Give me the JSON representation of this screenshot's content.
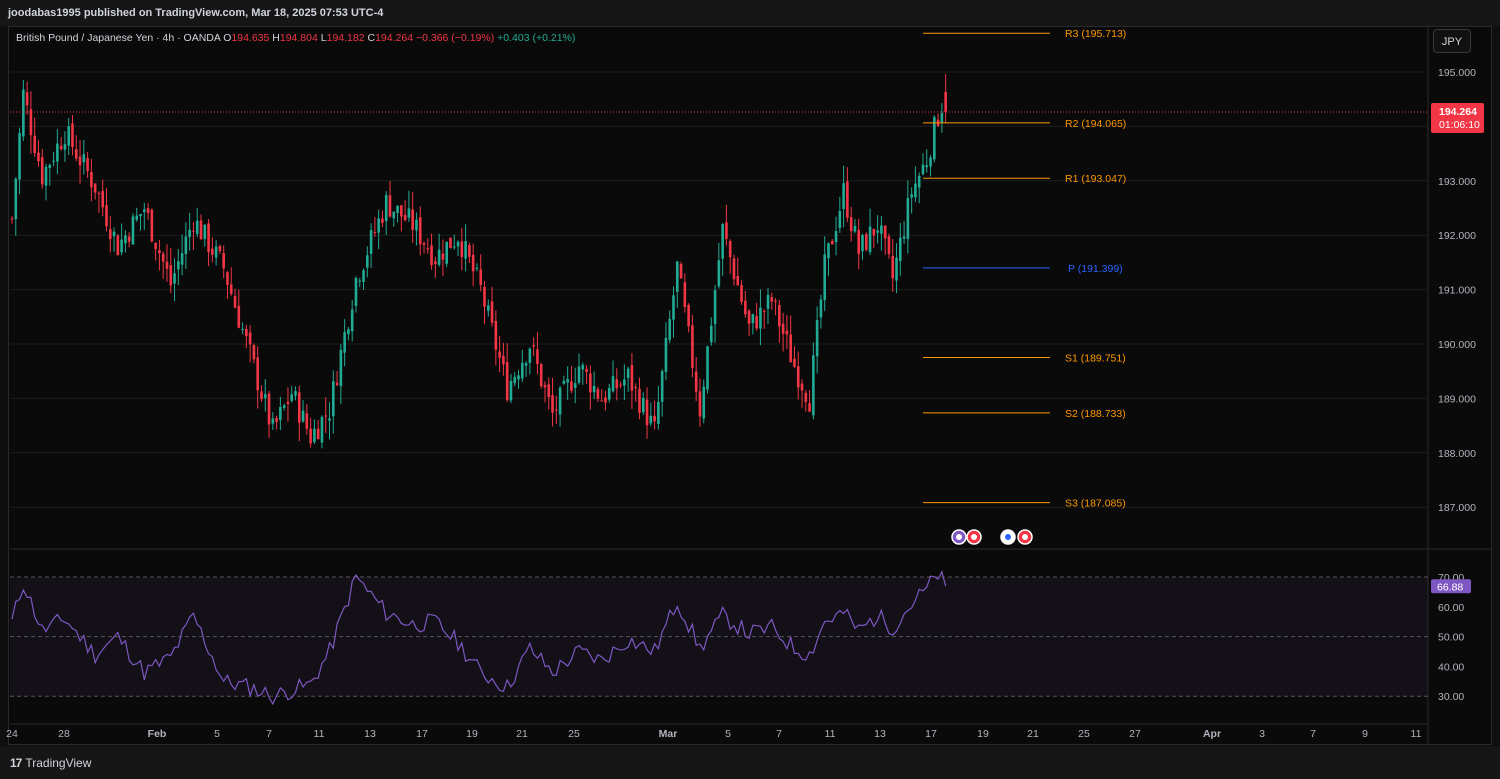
{
  "header": {
    "publisher_line": "joodabas1995 published on TradingView.com, Mar 18, 2025 07:53 UTC-4"
  },
  "legend": {
    "symbol": "British Pound / Japanese Yen · 4h · OANDA",
    "open_label": "O",
    "open": "194.635",
    "high_label": "H",
    "high": "194.804",
    "low_label": "L",
    "low": "194.182",
    "close_label": "C",
    "close": "194.264",
    "change": "−0.366 (−0.19%)",
    "indicator_change": "+0.403 (+0.21%)"
  },
  "currency_button": "JPY",
  "colors": {
    "up": "#22ab94",
    "down": "#f23645",
    "pivot": "#2962ff",
    "level": "#ff9800",
    "rsi": "#7e57c2",
    "price_tag": "#f23645"
  },
  "footer": {
    "brand": "TradingView",
    "brand_icon": "tradingview-logo-icon"
  },
  "events": [
    "lightning-event-icon",
    "event-target-icon",
    "uk-flag-event-icon",
    "event-target-icon"
  ],
  "chart_data": [
    {
      "type": "candlestick",
      "symbol": "GBPJPY",
      "timeframe": "4h",
      "ylim": [
        186.4,
        196.3
      ],
      "y_ticks": [
        "187.000",
        "188.000",
        "189.000",
        "190.000",
        "191.000",
        "192.000",
        "193.000",
        "194.000",
        "195.000"
      ],
      "x_ticks": [
        "24",
        "28",
        "Feb",
        "5",
        "7",
        "9",
        "11",
        "13",
        "17",
        "19",
        "21",
        "25",
        "Mar",
        "5",
        "7",
        "11",
        "13",
        "17",
        "19",
        "21",
        "25",
        "27",
        "Apr",
        "3",
        "7",
        "9",
        "11"
      ],
      "current_price": {
        "price": 194.264,
        "label": "194.264",
        "countdown": "01:06:10"
      },
      "price_path": [
        [
          0,
          192.3
        ],
        [
          3,
          194.6
        ],
        [
          8,
          193.1
        ],
        [
          14,
          193.9
        ],
        [
          22,
          192.9
        ],
        [
          28,
          191.8
        ],
        [
          35,
          192.5
        ],
        [
          42,
          191.1
        ],
        [
          48,
          192.3
        ],
        [
          56,
          191.4
        ],
        [
          63,
          189.8
        ],
        [
          69,
          188.4
        ],
        [
          74,
          189.1
        ],
        [
          79,
          188.3
        ],
        [
          84,
          188.8
        ],
        [
          91,
          191.2
        ],
        [
          99,
          192.6
        ],
        [
          106,
          192.2
        ],
        [
          112,
          191.6
        ],
        [
          118,
          192.0
        ],
        [
          124,
          191.0
        ],
        [
          131,
          189.2
        ],
        [
          137,
          190.0
        ],
        [
          143,
          188.7
        ],
        [
          150,
          189.6
        ],
        [
          156,
          189.0
        ],
        [
          163,
          189.4
        ],
        [
          170,
          188.4
        ],
        [
          176,
          191.4
        ],
        [
          182,
          188.8
        ],
        [
          188,
          192.1
        ],
        [
          195,
          190.3
        ],
        [
          201,
          190.8
        ],
        [
          207,
          189.6
        ],
        [
          211,
          189.0
        ],
        [
          215,
          191.4
        ],
        [
          220,
          192.8
        ],
        [
          224,
          191.7
        ],
        [
          229,
          192.2
        ],
        [
          233,
          191.2
        ],
        [
          238,
          192.8
        ],
        [
          242,
          193.4
        ],
        [
          245,
          194.2
        ],
        [
          247,
          194.6
        ]
      ],
      "pivot_levels": [
        {
          "label": "R3 (195.713)",
          "value": 195.713,
          "kind": "resistance"
        },
        {
          "label": "R2 (194.065)",
          "value": 194.065,
          "kind": "resistance"
        },
        {
          "label": "R1 (193.047)",
          "value": 193.047,
          "kind": "resistance"
        },
        {
          "label": "P (191.399)",
          "value": 191.399,
          "kind": "pivot"
        },
        {
          "label": "S1 (189.751)",
          "value": 189.751,
          "kind": "support"
        },
        {
          "label": "S2 (188.733)",
          "value": 188.733,
          "kind": "support"
        },
        {
          "label": "S3 (187.085)",
          "value": 187.085,
          "kind": "support"
        }
      ]
    },
    {
      "type": "line",
      "name": "RSI",
      "ylim": [
        25,
        75
      ],
      "y_ticks": [
        "30.00",
        "40.00",
        "50.00",
        "60.00",
        "70.00"
      ],
      "bands": [
        30,
        50,
        70
      ],
      "current": "66.88",
      "rsi_path": [
        [
          0,
          55
        ],
        [
          3,
          68
        ],
        [
          8,
          52
        ],
        [
          14,
          56
        ],
        [
          22,
          44
        ],
        [
          28,
          50
        ],
        [
          35,
          38
        ],
        [
          42,
          43
        ],
        [
          48,
          57
        ],
        [
          56,
          35
        ],
        [
          63,
          33
        ],
        [
          69,
          30
        ],
        [
          74,
          32
        ],
        [
          79,
          34
        ],
        [
          84,
          45
        ],
        [
          91,
          70
        ],
        [
          99,
          58
        ],
        [
          106,
          54
        ],
        [
          112,
          55
        ],
        [
          118,
          48
        ],
        [
          124,
          38
        ],
        [
          131,
          33
        ],
        [
          137,
          46
        ],
        [
          143,
          38
        ],
        [
          150,
          45
        ],
        [
          156,
          42
        ],
        [
          163,
          49
        ],
        [
          170,
          45
        ],
        [
          176,
          62
        ],
        [
          182,
          46
        ],
        [
          188,
          57
        ],
        [
          195,
          51
        ],
        [
          201,
          53
        ],
        [
          207,
          46
        ],
        [
          211,
          44
        ],
        [
          215,
          55
        ],
        [
          220,
          58
        ],
        [
          224,
          52
        ],
        [
          229,
          57
        ],
        [
          233,
          53
        ],
        [
          238,
          61
        ],
        [
          242,
          66
        ],
        [
          245,
          71
        ],
        [
          247,
          67
        ]
      ]
    }
  ]
}
